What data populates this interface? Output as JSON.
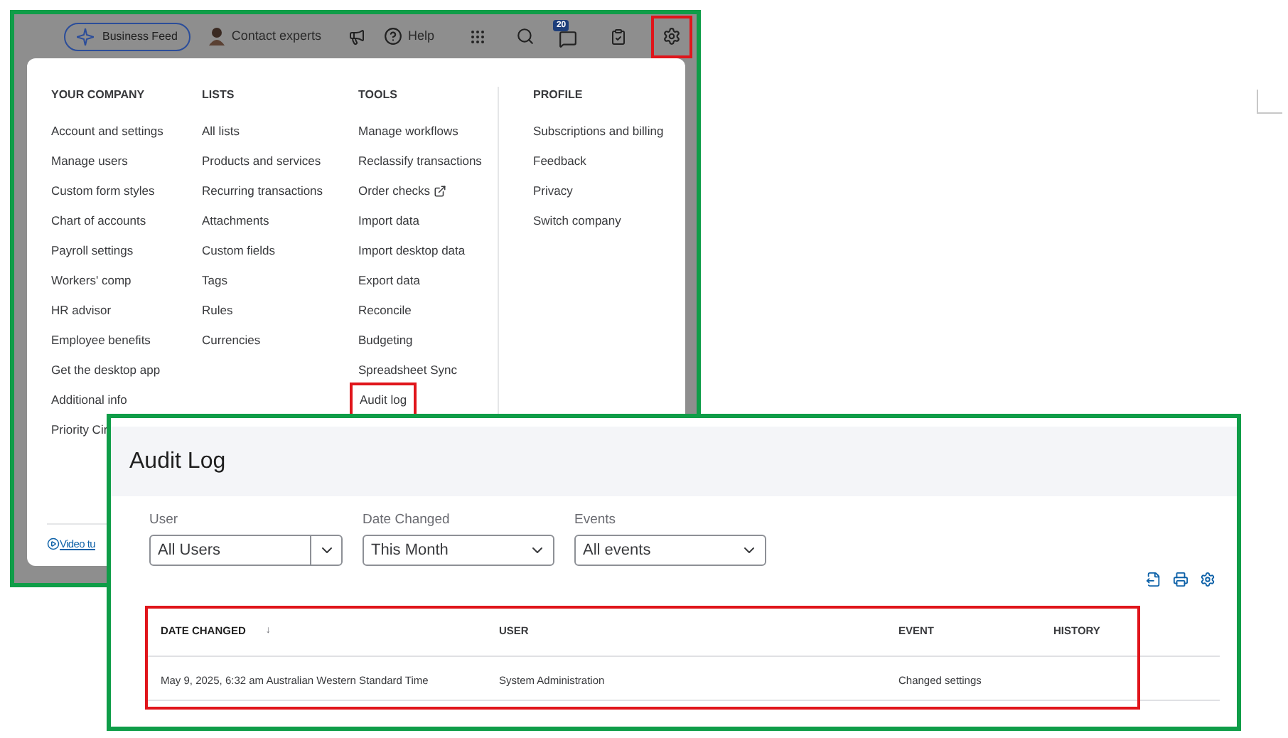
{
  "app_screenshot": {
    "top_bar": {
      "business_feed": "Business Feed",
      "contact_experts": "Contact experts",
      "help": "Help",
      "notification_count": "20",
      "settings_highlighted": true
    },
    "settings_menu": {
      "columns": [
        {
          "heading": "YOUR COMPANY",
          "items": [
            {
              "label": "Account and settings",
              "kind": "link",
              "highlighted": false
            },
            {
              "label": "Manage users",
              "kind": "link",
              "highlighted": false
            },
            {
              "label": "Custom form styles",
              "kind": "link",
              "highlighted": false
            },
            {
              "label": "Chart of accounts",
              "kind": "link",
              "highlighted": false
            },
            {
              "label": "Payroll settings",
              "kind": "link",
              "highlighted": false
            },
            {
              "label": "Workers' comp",
              "kind": "link",
              "highlighted": false
            },
            {
              "label": "HR advisor",
              "kind": "link",
              "highlighted": false
            },
            {
              "label": "Employee benefits",
              "kind": "link",
              "highlighted": false
            },
            {
              "label": "Get the desktop app",
              "kind": "link",
              "highlighted": false
            },
            {
              "label": "Additional info",
              "kind": "link",
              "highlighted": false
            },
            {
              "label": "Priority Cir",
              "kind": "link",
              "highlighted": false
            }
          ]
        },
        {
          "heading": "LISTS",
          "items": [
            {
              "label": "All lists",
              "kind": "link",
              "highlighted": false
            },
            {
              "label": "Products and services",
              "kind": "link",
              "highlighted": false
            },
            {
              "label": "Recurring transactions",
              "kind": "link",
              "highlighted": false
            },
            {
              "label": "Attachments",
              "kind": "link",
              "highlighted": false
            },
            {
              "label": "Custom fields",
              "kind": "link",
              "highlighted": false
            },
            {
              "label": "Tags",
              "kind": "link",
              "highlighted": false
            },
            {
              "label": "Rules",
              "kind": "link",
              "highlighted": false
            },
            {
              "label": "Currencies",
              "kind": "link",
              "highlighted": false
            }
          ]
        },
        {
          "heading": "TOOLS",
          "items": [
            {
              "label": "Manage workflows",
              "kind": "link",
              "highlighted": false
            },
            {
              "label": "Reclassify transactions",
              "kind": "link",
              "highlighted": false
            },
            {
              "label": "Order checks",
              "kind": "external",
              "highlighted": false
            },
            {
              "label": "Import data",
              "kind": "link",
              "highlighted": false
            },
            {
              "label": "Import desktop data",
              "kind": "link",
              "highlighted": false
            },
            {
              "label": "Export data",
              "kind": "link",
              "highlighted": false
            },
            {
              "label": "Reconcile",
              "kind": "link",
              "highlighted": false
            },
            {
              "label": "Budgeting",
              "kind": "link",
              "highlighted": false
            },
            {
              "label": "Spreadsheet Sync",
              "kind": "link",
              "highlighted": false
            },
            {
              "label": "Audit log",
              "kind": "link",
              "highlighted": true
            }
          ]
        },
        {
          "heading": "PROFILE",
          "items": [
            {
              "label": "Subscriptions and billing",
              "kind": "link",
              "highlighted": false
            },
            {
              "label": "Feedback",
              "kind": "link",
              "highlighted": false
            },
            {
              "label": "Privacy",
              "kind": "link",
              "highlighted": false
            },
            {
              "label": "Switch company",
              "kind": "link",
              "highlighted": false
            }
          ]
        }
      ],
      "footer_link": "Video tu"
    }
  },
  "audit_log": {
    "title": "Audit Log",
    "filters": [
      {
        "label": "User",
        "value": "All Users",
        "kind": "split"
      },
      {
        "label": "Date Changed",
        "value": "This Month",
        "kind": "plain"
      },
      {
        "label": "Events",
        "value": "All events",
        "kind": "plain"
      }
    ],
    "table": {
      "highlighted": true,
      "columns": [
        {
          "label": "DATE CHANGED",
          "sorted": true
        },
        {
          "label": "USER",
          "sorted": false
        },
        {
          "label": "EVENT",
          "sorted": false
        },
        {
          "label": "HISTORY",
          "sorted": false
        }
      ],
      "sort_arrow": "↓",
      "rows": [
        [
          "May 9, 2025, 6:32 am Australian Western Standard Time",
          "System Administration",
          "Changed settings",
          ""
        ]
      ]
    }
  }
}
